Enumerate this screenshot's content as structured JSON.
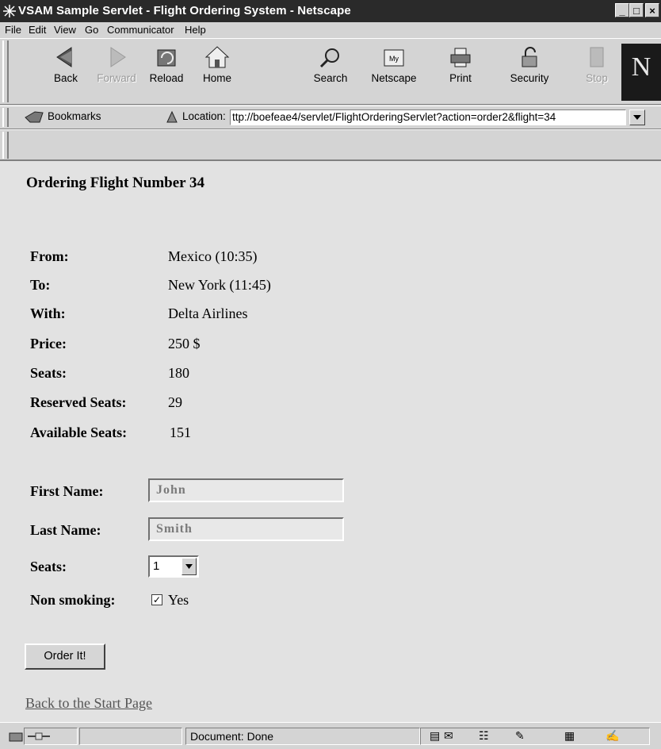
{
  "window": {
    "title": "VSAM Sample Servlet - Flight Ordering System - Netscape",
    "buttons": {
      "minimize": "_",
      "maximize": "□",
      "close": "×"
    }
  },
  "menu": [
    "File",
    "Edit",
    "View",
    "Go",
    "Communicator",
    "Help"
  ],
  "toolbar": {
    "buttons": [
      {
        "label": "Back",
        "icon": "back-arrow-icon",
        "enabled": true
      },
      {
        "label": "Forward",
        "icon": "forward-arrow-icon",
        "enabled": false
      },
      {
        "label": "Reload",
        "icon": "reload-icon",
        "enabled": true
      },
      {
        "label": "Home",
        "icon": "home-icon",
        "enabled": true
      },
      {
        "label": "Search",
        "icon": "search-icon",
        "enabled": true
      },
      {
        "label": "Netscape",
        "icon": "my-netscape-icon",
        "enabled": true
      },
      {
        "label": "Print",
        "icon": "printer-icon",
        "enabled": true
      },
      {
        "label": "Security",
        "icon": "padlock-icon",
        "enabled": true
      },
      {
        "label": "Stop",
        "icon": "stop-icon",
        "enabled": false
      }
    ],
    "logo": "N"
  },
  "location": {
    "bookmarks_label": "Bookmarks",
    "location_label": "Location:",
    "url": "ttp://boefeae4/servlet/FlightOrderingServlet?action=order2&flight=34"
  },
  "page": {
    "heading": "Ordering Flight Number 34",
    "details": [
      {
        "key": "From:",
        "value": "Mexico (10:35)"
      },
      {
        "key": "To:",
        "value": "New York (11:45)"
      },
      {
        "key": "With:",
        "value": "Delta Airlines"
      },
      {
        "key": "Price:",
        "value": "250 $"
      },
      {
        "key": "Seats:",
        "value": "180"
      },
      {
        "key": "Reserved Seats:",
        "value": "29"
      },
      {
        "key": "Available Seats:",
        "value": "151"
      }
    ],
    "form": {
      "first_name_label": "First Name:",
      "first_name_value": "John",
      "last_name_label": "Last Name:",
      "last_name_value": "Smith",
      "seats_label": "Seats:",
      "seats_value": "1",
      "non_smoking_label": "Non smoking:",
      "non_smoking_checked": true,
      "non_smoking_option": "Yes",
      "submit_label": "Order It!"
    },
    "back_link": "Back to the Start Page"
  },
  "status": {
    "text": "Document: Done"
  }
}
